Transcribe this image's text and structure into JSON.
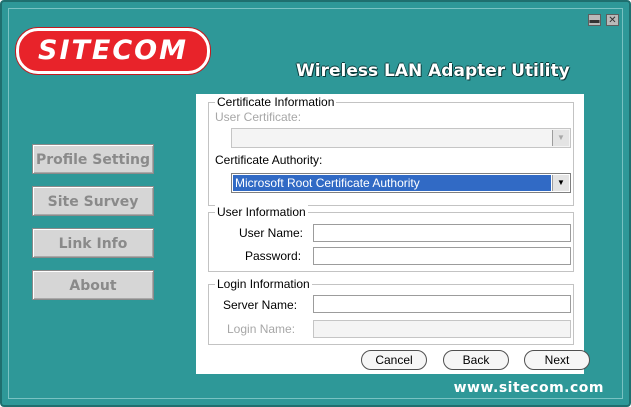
{
  "app": {
    "logo_text": "SITECOM",
    "title": "Wireless LAN Adapter Utility",
    "footer_url": "www.sitecom.com",
    "minimize_glyph": "▬",
    "close_glyph": "✕"
  },
  "sidebar": {
    "items": [
      {
        "label": "Profile Setting"
      },
      {
        "label": "Site Survey"
      },
      {
        "label": "Link Info"
      },
      {
        "label": "About"
      }
    ]
  },
  "certificate": {
    "legend": "Certificate Information",
    "user_cert_label": "User Certificate:",
    "user_cert_value": "",
    "authority_label": "Certificate Authority:",
    "authority_value": "Microsoft Root Certificate Authority"
  },
  "user_info": {
    "legend": "User Information",
    "username_label": "User Name:",
    "username_value": "",
    "password_label": "Password:",
    "password_value": ""
  },
  "login_info": {
    "legend": "Login Information",
    "server_label": "Server Name:",
    "server_value": "",
    "login_label": "Login Name:",
    "login_value": ""
  },
  "buttons": {
    "cancel": "Cancel",
    "back": "Back",
    "next": "Next"
  },
  "colors": {
    "background": "#2e9898",
    "logo_red": "#e8232a",
    "selection": "#316ac5"
  }
}
